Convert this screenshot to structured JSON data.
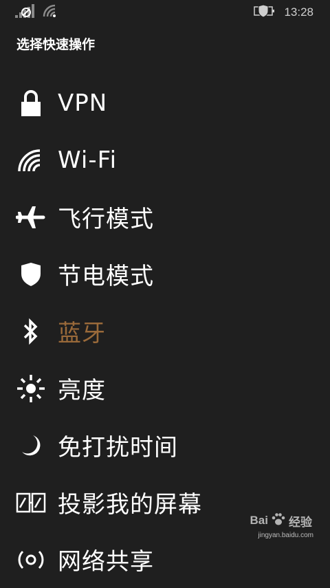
{
  "status_bar": {
    "time": "13:28",
    "icons": [
      "cellular-no-signal-icon",
      "wifi-signal-icon",
      "battery-saver-icon"
    ]
  },
  "page": {
    "title": "选择快速操作"
  },
  "actions": [
    {
      "label": "VPN",
      "icon": "lock-icon",
      "enabled": true
    },
    {
      "label": "Wi-Fi",
      "icon": "wifi-icon",
      "enabled": true
    },
    {
      "label": "飞行模式",
      "icon": "airplane-icon",
      "enabled": true
    },
    {
      "label": "节电模式",
      "icon": "battery-saver-shield-icon",
      "enabled": true
    },
    {
      "label": "蓝牙",
      "icon": "bluetooth-icon",
      "enabled": false
    },
    {
      "label": "亮度",
      "icon": "brightness-icon",
      "enabled": true
    },
    {
      "label": "免打扰时间",
      "icon": "quiet-hours-moon-icon",
      "enabled": true
    },
    {
      "label": "投影我的屏幕",
      "icon": "project-screen-icon",
      "enabled": true
    },
    {
      "label": "网络共享",
      "icon": "internet-sharing-icon",
      "enabled": true
    }
  ],
  "watermark": {
    "brand": "Bai",
    "brand_suffix": "经验",
    "url": "jingyan.baidu.com"
  },
  "colors": {
    "background": "#1f1f1f",
    "text": "#ffffff",
    "disabled_text": "#9a6a3a"
  }
}
